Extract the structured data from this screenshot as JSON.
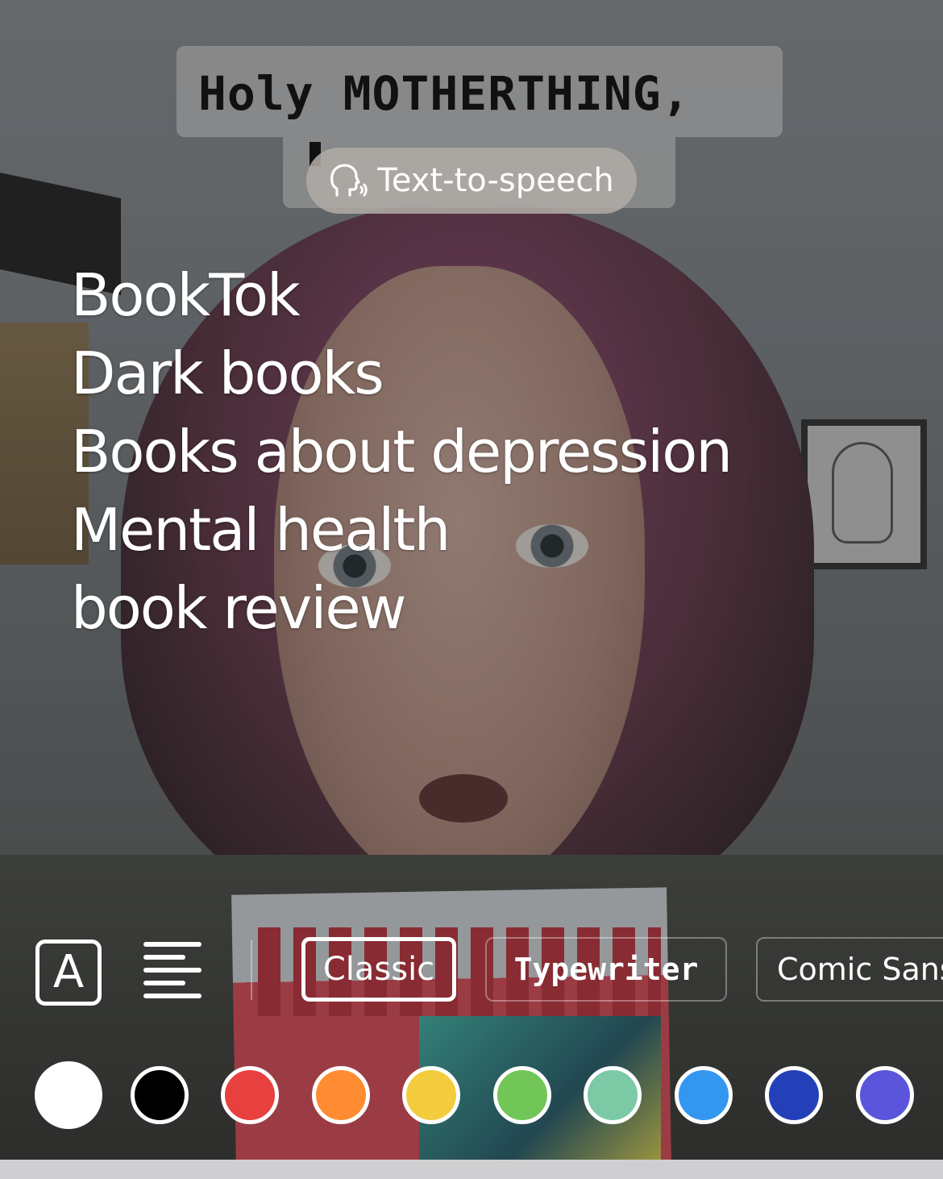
{
  "caption": {
    "first_line": "Holy MOTHERTHING,"
  },
  "text_to_speech": {
    "label": "Text-to-speech",
    "icon": "speaking-head-icon"
  },
  "overlay_text": {
    "lines": [
      "BookTok",
      "Dark books",
      "Books about depression",
      "Mental health",
      "book review"
    ]
  },
  "toolbar": {
    "text_style_glyph": "A",
    "text_style_icon": "text-background-icon",
    "align_icon": "align-left-icon",
    "fonts": [
      {
        "label": "Classic",
        "selected": true
      },
      {
        "label": "Typewriter",
        "selected": false
      },
      {
        "label": "Comic Sans",
        "selected": false
      }
    ]
  },
  "colors": [
    {
      "name": "white",
      "hex": "#FFFFFF",
      "selected": true
    },
    {
      "name": "black",
      "hex": "#000000",
      "selected": false
    },
    {
      "name": "red",
      "hex": "#E8403F",
      "selected": false
    },
    {
      "name": "orange",
      "hex": "#FF8C33",
      "selected": false
    },
    {
      "name": "yellow",
      "hex": "#F2CC3D",
      "selected": false
    },
    {
      "name": "green",
      "hex": "#72C657",
      "selected": false
    },
    {
      "name": "mint",
      "hex": "#7CC9A6",
      "selected": false
    },
    {
      "name": "sky-blue",
      "hex": "#3397F0",
      "selected": false
    },
    {
      "name": "navy-blue",
      "hex": "#2340B8",
      "selected": false
    },
    {
      "name": "purple",
      "hex": "#5A55DB",
      "selected": false
    }
  ]
}
